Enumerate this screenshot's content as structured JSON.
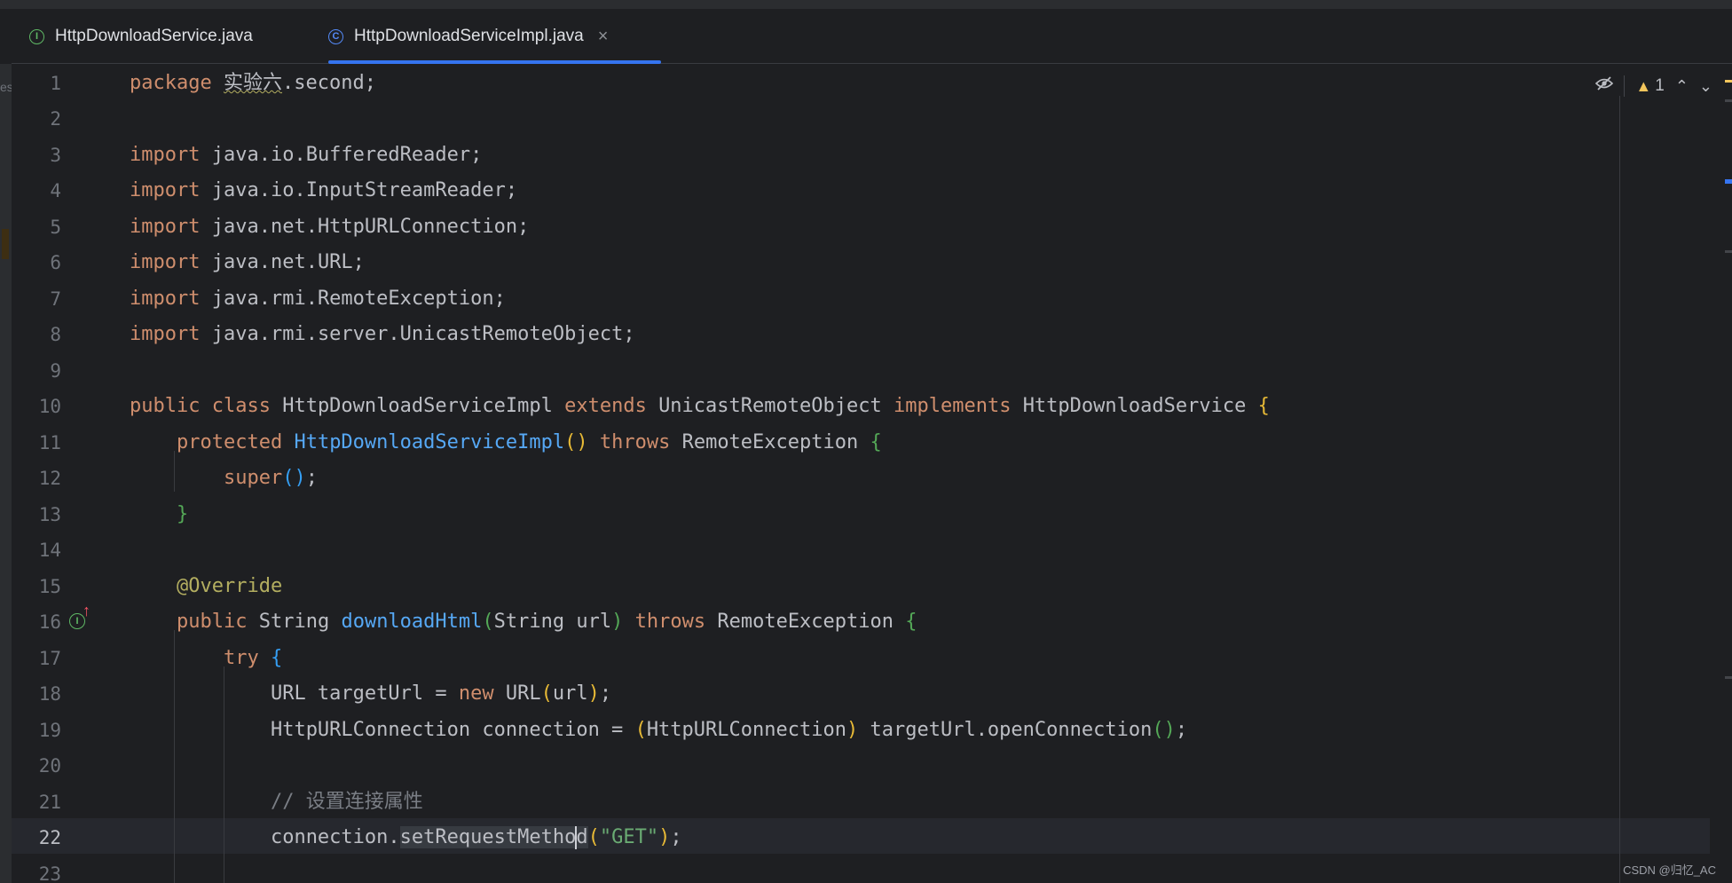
{
  "tabs": [
    {
      "label": "HttpDownloadService.java",
      "icon": "interface-icon",
      "icon_glyph": "I",
      "active": false
    },
    {
      "label": "HttpDownloadServiceImpl.java",
      "icon": "class-icon",
      "icon_glyph": "C",
      "active": true,
      "close": "×"
    }
  ],
  "sidebar": {
    "cut_text": "es"
  },
  "toolbar": {
    "warning_count": "1",
    "eye_icon": "eye-hidden-icon"
  },
  "editor": {
    "current_line": 22,
    "line_numbers": [
      "1",
      "2",
      "3",
      "4",
      "5",
      "6",
      "7",
      "8",
      "9",
      "10",
      "11",
      "12",
      "13",
      "14",
      "15",
      "16",
      "17",
      "18",
      "19",
      "20",
      "21",
      "22",
      "23"
    ],
    "gutter_icon_glyph": "I",
    "gutter_arrow_glyph": "↑",
    "code": {
      "l1_kw": "package",
      "l1_pkg": "实验六",
      "l1_rest": ".second;",
      "l3_kw": "import",
      "l3_rest": "java.io.BufferedReader;",
      "l4_kw": "import",
      "l4_rest": "java.io.InputStreamReader;",
      "l5_kw": "import",
      "l5_rest": "java.net.HttpURLConnection;",
      "l6_kw": "import",
      "l6_rest": "java.net.URL;",
      "l7_kw": "import",
      "l7_rest": "java.rmi.RemoteException;",
      "l8_kw": "import",
      "l8_rest": "java.rmi.server.UnicastRemoteObject;",
      "l10_kw1": "public class",
      "l10_name": "HttpDownloadServiceImpl",
      "l10_kw2": "extends",
      "l10_parent": "UnicastRemoteObject",
      "l10_kw3": "implements",
      "l10_iface": "HttpDownloadService",
      "l10_brace": "{",
      "l11_kw": "protected",
      "l11_fn": "HttpDownloadServiceImpl",
      "l11_parens": "()",
      "l11_kw2": "throws",
      "l11_ex": "RemoteException",
      "l11_brace": "{",
      "l12_kw": "super",
      "l12_parens": "()",
      "l12_semi": ";",
      "l13_brace": "}",
      "l15_an": "@Override",
      "l16_kw": "public",
      "l16_type": "String",
      "l16_fn": "downloadHtml",
      "l16_po": "(",
      "l16_params": "String url",
      "l16_pc": ")",
      "l16_kw2": "throws",
      "l16_ex": "RemoteException",
      "l16_brace": "{",
      "l17_kw": "try",
      "l17_brace": "{",
      "l18_pre": "URL targetUrl = ",
      "l18_kw": "new",
      "l18_type": "URL",
      "l18_po": "(",
      "l18_arg": "url",
      "l18_pc": ")",
      "l18_semi": ";",
      "l19_pre": "HttpURLConnection connection = ",
      "l19_po": "(",
      "l19_cast": "HttpURLConnection",
      "l19_pc": ")",
      "l19_call": "targetUrl.openConnection",
      "l19_parens": "()",
      "l19_semi": ";",
      "l21_cm": "// 设置连接属性",
      "l22_pre": "connection.",
      "l22_hl_a": "setRequestMetho",
      "l22_hl_b": "d",
      "l22_po": "(",
      "l22_str": "\"GET\"",
      "l22_pc": ")",
      "l22_semi": ";"
    }
  },
  "watermark": "CSDN @归忆_AC"
}
